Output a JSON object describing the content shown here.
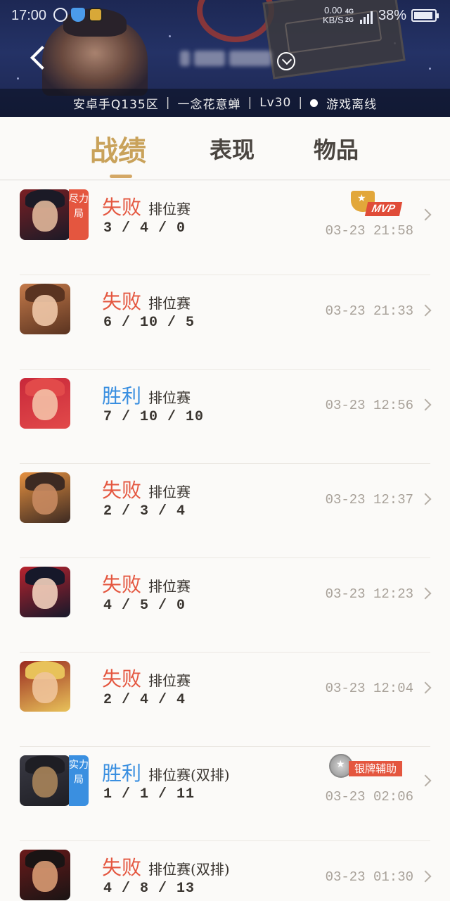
{
  "status_bar": {
    "time": "17:00",
    "net_speed": "0.00",
    "net_unit": "KB/S",
    "net_tag_1": "4G",
    "net_tag_2": "2G",
    "battery": "38%"
  },
  "profile": {
    "server": "安卓手Q135区",
    "title": "一念花意蝉",
    "level": "Lv30",
    "status": "游戏离线"
  },
  "tabs": [
    {
      "label": "战绩",
      "active": true
    },
    {
      "label": "表现",
      "active": false
    },
    {
      "label": "物品",
      "active": false
    }
  ],
  "matches": [
    {
      "result": "失败",
      "outcome": "loss",
      "mode": "排位赛",
      "kda": "3 / 4 / 0",
      "time": "03-23 21:58",
      "tag": "尽力局",
      "tag_color": "#e4563f",
      "award": "MVP",
      "avatar_colors": [
        "#7a1f24",
        "#e0b79a",
        "#1b1a26"
      ]
    },
    {
      "result": "失败",
      "outcome": "loss",
      "mode": "排位赛",
      "kda": "6 / 10 / 5",
      "time": "03-23 21:33",
      "tag": "",
      "award": "",
      "avatar_colors": [
        "#c47a4a",
        "#f0c8a8",
        "#5a3320"
      ]
    },
    {
      "result": "胜利",
      "outcome": "win",
      "mode": "排位赛",
      "kda": "7 / 10 / 10",
      "time": "03-23 12:56",
      "tag": "",
      "award": "",
      "avatar_colors": [
        "#c8283a",
        "#f4c0a6",
        "#e24a4a"
      ]
    },
    {
      "result": "失败",
      "outcome": "loss",
      "mode": "排位赛",
      "kda": "2 / 3 / 4",
      "time": "03-23 12:37",
      "tag": "",
      "award": "",
      "avatar_colors": [
        "#e49040",
        "#c88a60",
        "#3d2a22"
      ]
    },
    {
      "result": "失败",
      "outcome": "loss",
      "mode": "排位赛",
      "kda": "4 / 5 / 0",
      "time": "03-23 12:23",
      "tag": "",
      "award": "",
      "avatar_colors": [
        "#b8232e",
        "#f2d0bc",
        "#16182a"
      ]
    },
    {
      "result": "失败",
      "outcome": "loss",
      "mode": "排位赛",
      "kda": "2 / 4 / 4",
      "time": "03-23 12:04",
      "tag": "",
      "award": "",
      "avatar_colors": [
        "#9a2a20",
        "#f0c49a",
        "#e8c25a"
      ]
    },
    {
      "result": "胜利",
      "outcome": "win",
      "mode": "排位赛(双排)",
      "kda": "1 / 1 / 11",
      "time": "03-23 02:06",
      "tag": "实力局",
      "tag_color": "#3a8fe0",
      "award": "银牌辅助",
      "avatar_colors": [
        "#3a3a44",
        "#a8845a",
        "#1e1e24"
      ]
    },
    {
      "result": "失败",
      "outcome": "loss",
      "mode": "排位赛(双排)",
      "kda": "4 / 8 / 13",
      "time": "03-23 01:30",
      "tag": "",
      "award": "",
      "avatar_colors": [
        "#6a1a1a",
        "#d89a72",
        "#1a1414"
      ]
    }
  ]
}
